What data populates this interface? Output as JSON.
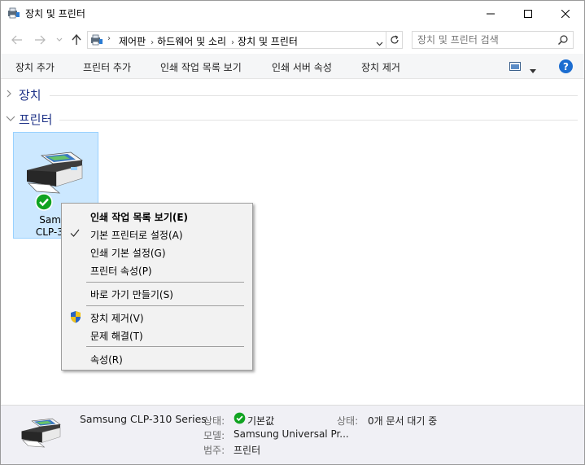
{
  "window": {
    "title": "장치 및 프린터"
  },
  "nav": {
    "breadcrumb": [
      "제어판",
      "하드웨어 및 소리",
      "장치 및 프린터"
    ],
    "search_placeholder": "장치 및 프린터 검색"
  },
  "toolbar": {
    "commands": [
      "장치 추가",
      "프린터 추가",
      "인쇄 작업 목록 보기",
      "인쇄 서버 속성",
      "장치 제거"
    ],
    "help_label": "?"
  },
  "groups": {
    "devices": "장치",
    "printers": "프린터"
  },
  "printer": {
    "label_line1": "Samsu",
    "label_line2": "CLP-310"
  },
  "context_menu": {
    "items": [
      {
        "label": "인쇄 작업 목록 보기(E)"
      },
      {
        "label": "기본 프린터로 설정(A)"
      },
      {
        "label": "인쇄 기본 설정(G)"
      },
      {
        "label": "프린터 속성(P)"
      },
      {
        "label": "바로 가기 만들기(S)"
      },
      {
        "label": "장치 제거(V)"
      },
      {
        "label": "문제 해결(T)"
      },
      {
        "label": "속성(R)"
      }
    ]
  },
  "details": {
    "name": "Samsung CLP-310 Series",
    "state_label": "상태:",
    "state_value": "기본값",
    "model_label": "모델:",
    "model_value": "Samsung Universal Pr...",
    "category_label": "범주:",
    "category_value": "프린터",
    "status_label": "상태:",
    "status_value": "0개 문서 대기 중"
  },
  "colors": {
    "accent": "#1c6dd0",
    "selection": "#cce8ff",
    "group_title": "#1e3287",
    "check_green": "#10a321"
  }
}
